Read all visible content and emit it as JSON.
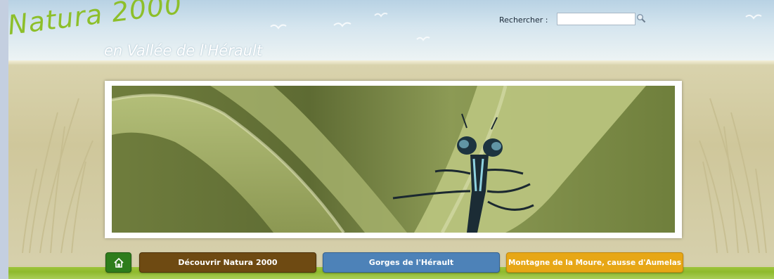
{
  "header": {
    "logo_main": "Natura 2000",
    "logo_sub": "en Vallée de l'Hérault",
    "search_label": "Rechercher :",
    "search_value": "",
    "search_icon": "magnifier-icon"
  },
  "banner": {
    "photo": "damselfly-on-leaf-photo"
  },
  "nav": {
    "home_icon": "home-icon",
    "items": [
      {
        "label": "Découvrir Natura 2000",
        "color": "#6e4a12"
      },
      {
        "label": "Gorges de l'Hérault",
        "color": "#4d82b8"
      },
      {
        "label": "Montagne de la Moure, causse d'Aumelas",
        "color": "#e7a716"
      }
    ]
  },
  "colors": {
    "logo_green": "#8dbf2a",
    "nav_line_green": "#9dc53a",
    "page_beige": "#d5cfa8",
    "sky_blue": "#b8d2e4"
  }
}
